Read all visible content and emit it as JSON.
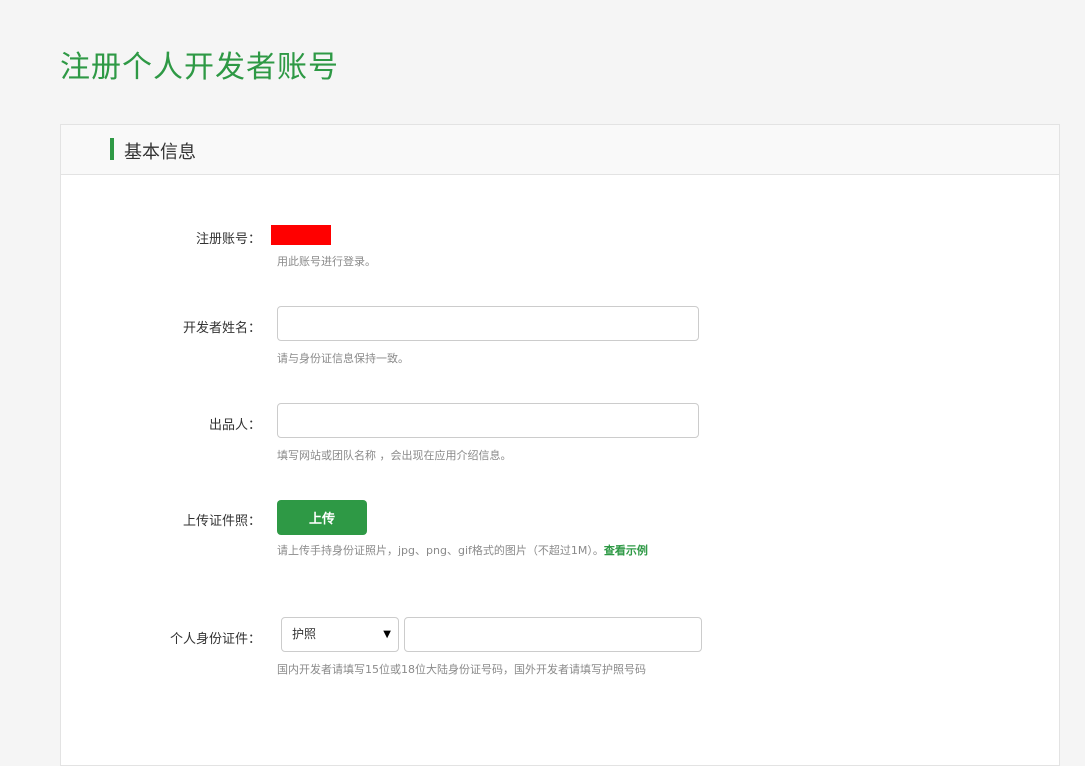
{
  "page_title": "注册个人开发者账号",
  "section": {
    "title": "基本信息"
  },
  "form": {
    "account": {
      "label": "注册账号：",
      "hint": "用此账号进行登录。"
    },
    "developer_name": {
      "label": "开发者姓名：",
      "value": "",
      "hint": "请与身份证信息保持一致。"
    },
    "publisher": {
      "label": "出品人：",
      "value": "",
      "hint": "填写网站或团队名称 ，会出现在应用介绍信息。"
    },
    "certificate": {
      "label": "上传证件照：",
      "button": "上传",
      "hint": "请上传手持身份证照片，jpg、png、gif格式的图片（不超过1M）。",
      "example_link": "查看示例"
    },
    "id_document": {
      "label": "个人身份证件：",
      "type_selected": "护照",
      "value": "",
      "hint": "国内开发者请填写15位或18位大陆身份证号码，国外开发者请填写护照号码"
    }
  },
  "colors": {
    "accent": "#2e9945",
    "redaction": "#ff0000"
  }
}
